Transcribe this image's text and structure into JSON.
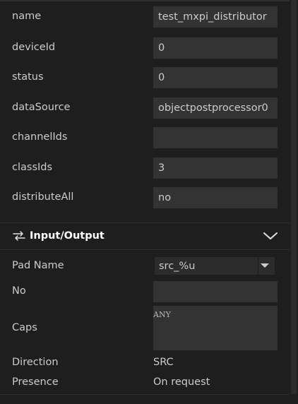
{
  "properties": [
    {
      "label": "name",
      "value": "test_mxpi_distributor"
    },
    {
      "label": "deviceId",
      "value": "0"
    },
    {
      "label": "status",
      "value": "0"
    },
    {
      "label": "dataSource",
      "value": "objectpostprocessor0"
    },
    {
      "label": "channelIds",
      "value": ""
    },
    {
      "label": "classIds",
      "value": "3"
    },
    {
      "label": "distributeAll",
      "value": "no"
    }
  ],
  "io_section": {
    "title": "Input/Output",
    "icon": "input-output-icon",
    "collapse_icon": "chevron-down-icon"
  },
  "pad": {
    "pad_name_label": "Pad Name",
    "pad_name_value": "src_%u",
    "no_label": "No",
    "no_value": "",
    "caps_label": "Caps",
    "caps_value": "ANY",
    "direction_label": "Direction",
    "direction_value": "SRC",
    "presence_label": "Presence",
    "presence_value": "On request"
  }
}
